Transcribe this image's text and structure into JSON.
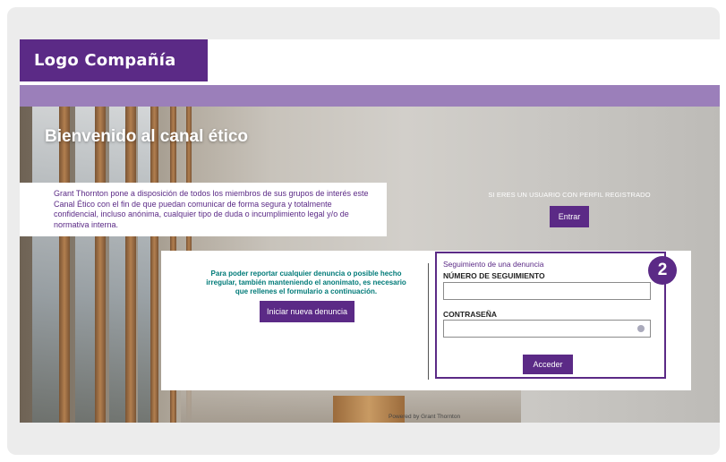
{
  "header": {
    "logo_text": "Logo Compañía"
  },
  "hero": {
    "title": "Bienvenido al canal ético",
    "intro": "Grant Thornton pone a disposición de todos los miembros de sus grupos de interés este Canal Ético con el fin de que puedan comunicar de forma segura y totalmente confidencial, incluso anónima, cualquier tipo de duda o incumplimiento legal y/o de normativa interna.",
    "registered_text": "SI ERES UN USUARIO CON PERFIL REGISTRADO",
    "enter_button": "Entrar"
  },
  "report": {
    "text": "Para poder reportar cualquier denuncia o posible hecho irregular, también manteniendo el anonimato, es necesario que rellenes el formulario a continuación.",
    "new_button": "Iniciar nueva denuncia"
  },
  "follow_up": {
    "heading": "Seguimiento de una denuncia",
    "tracking_label": "NÚMERO DE SEGUIMIENTO",
    "tracking_value": "",
    "password_label": "CONTRASEÑA",
    "password_value": "",
    "submit_button": "Acceder"
  },
  "badge": "2",
  "footer": {
    "powered": "Powered by Grant Thornton"
  },
  "colors": {
    "brand_purple": "#5b2a86",
    "band": "#9b7fba",
    "teal_text": "#007a78"
  },
  "icons": {
    "password_toggle": "eye-icon"
  }
}
